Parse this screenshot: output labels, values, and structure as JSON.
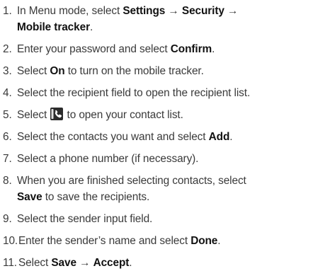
{
  "steps": [
    {
      "num": "1.",
      "parts": [
        {
          "t": "In Menu mode, select "
        },
        {
          "t": "Settings",
          "b": true
        },
        {
          "t": " → "
        },
        {
          "t": "Security",
          "b": true
        },
        {
          "t": " →\n"
        },
        {
          "t": "Mobile tracker",
          "b": true
        },
        {
          "t": "."
        }
      ]
    },
    {
      "num": "2.",
      "parts": [
        {
          "t": "Enter your password and select "
        },
        {
          "t": "Confirm",
          "b": true
        },
        {
          "t": "."
        }
      ]
    },
    {
      "num": "3.",
      "parts": [
        {
          "t": "Select "
        },
        {
          "t": "On",
          "b": true
        },
        {
          "t": " to turn on the mobile tracker."
        }
      ]
    },
    {
      "num": "4.",
      "parts": [
        {
          "t": "Select the recipient field to open the recipient list."
        }
      ]
    },
    {
      "num": "5.",
      "parts": [
        {
          "t": "Select "
        },
        {
          "icon": "contacts-phone-icon"
        },
        {
          "t": " to open your contact list."
        }
      ]
    },
    {
      "num": "6.",
      "parts": [
        {
          "t": "Select the contacts you want and select "
        },
        {
          "t": "Add",
          "b": true
        },
        {
          "t": "."
        }
      ]
    },
    {
      "num": "7.",
      "parts": [
        {
          "t": "Select a phone number (if necessary)."
        }
      ]
    },
    {
      "num": "8.",
      "parts": [
        {
          "t": "When you are finished selecting contacts, select\n"
        },
        {
          "t": "Save",
          "b": true
        },
        {
          "t": " to save the recipients."
        }
      ]
    },
    {
      "num": "9.",
      "parts": [
        {
          "t": "Select the sender input field."
        }
      ]
    },
    {
      "num": "10.",
      "parts": [
        {
          "t": "Enter the sender’s name and select "
        },
        {
          "t": "Done",
          "b": true
        },
        {
          "t": "."
        }
      ]
    },
    {
      "num": "11.",
      "parts": [
        {
          "t": "Select "
        },
        {
          "t": "Save",
          "b": true
        },
        {
          "t": " → "
        },
        {
          "t": "Accept",
          "b": true
        },
        {
          "t": "."
        }
      ]
    }
  ],
  "colors": {
    "text": "#3a3a3a",
    "emphasis": "#111111",
    "icon_bg": "#2b2b2b",
    "icon_fg": "#ffffff"
  }
}
